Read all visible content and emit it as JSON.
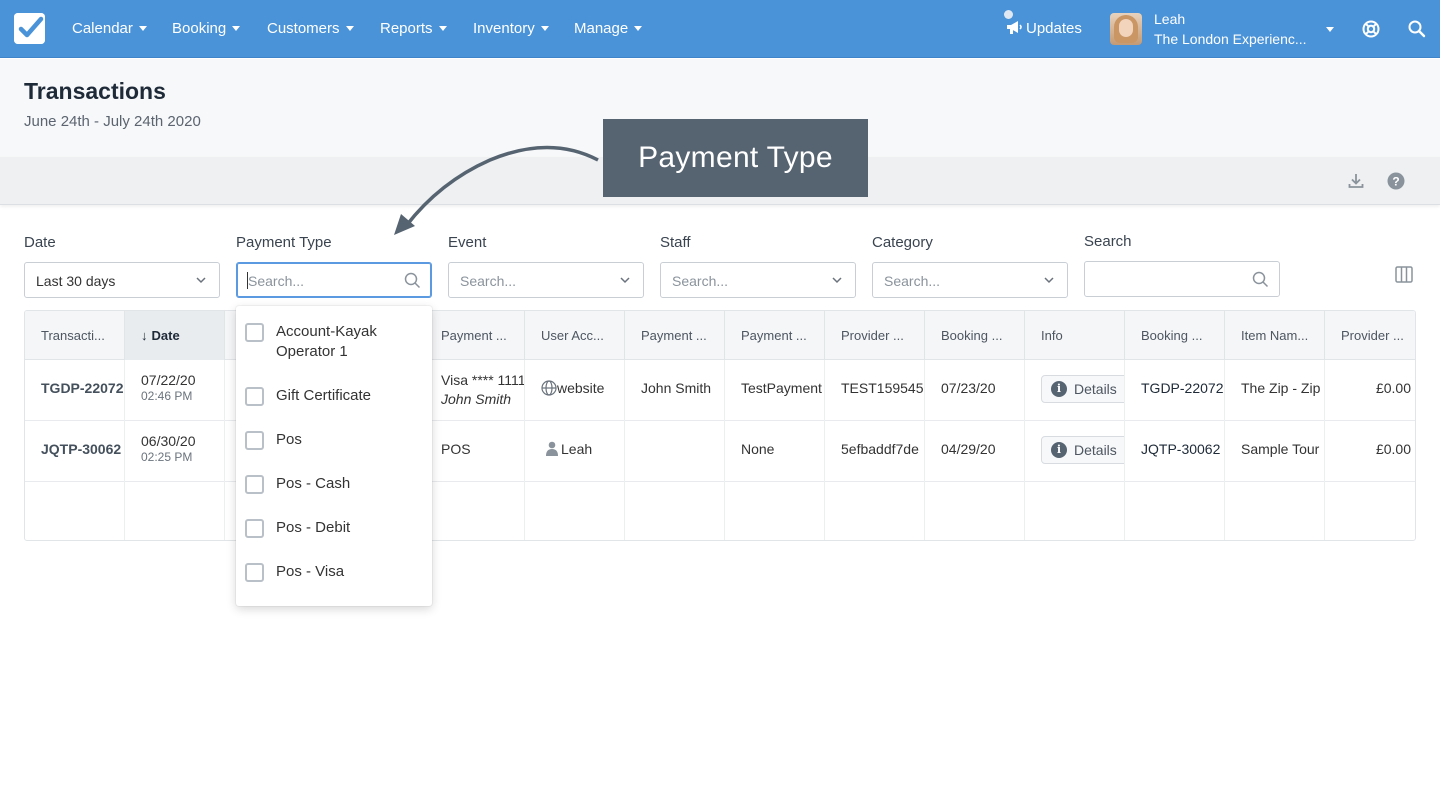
{
  "nav": {
    "items": [
      "Calendar",
      "Booking",
      "Customers",
      "Reports",
      "Inventory",
      "Manage"
    ],
    "updates_label": "Updates",
    "user_name": "Leah",
    "user_org": "The London Experienc..."
  },
  "page": {
    "title": "Transactions",
    "subtitle": "June 24th - July 24th 2020"
  },
  "callout": {
    "text": "Payment Type"
  },
  "filters": {
    "date": {
      "label": "Date",
      "value": "Last 30 days"
    },
    "payment_type": {
      "label": "Payment Type",
      "placeholder": "Search..."
    },
    "event": {
      "label": "Event",
      "placeholder": "Search..."
    },
    "staff": {
      "label": "Staff",
      "placeholder": "Search..."
    },
    "category": {
      "label": "Category",
      "placeholder": "Search..."
    },
    "search": {
      "label": "Search",
      "placeholder": ""
    }
  },
  "table": {
    "headers": [
      "Transacti...",
      "Date",
      "",
      "Payment ...",
      "User Acc...",
      "Payment ...",
      "Payment ...",
      "Provider ...",
      "Booking ...",
      "Info",
      "Booking ...",
      "Item Nam...",
      "Provider ..."
    ],
    "rows": [
      {
        "transaction": "TGDP-22072",
        "date": "07/22/20",
        "time": "02:46 PM",
        "payment_method": "Visa **** 1111",
        "payment_name": "John Smith",
        "user_account": "website",
        "payment_by": "John Smith",
        "payment_ref": "TestPayment",
        "provider_id": "TEST159545",
        "booking_date": "07/23/20",
        "info": "Details",
        "booking_code": "TGDP-22072",
        "item_name": "The Zip - Zip",
        "provider_amount": "£0.00"
      },
      {
        "transaction": "JQTP-30062",
        "date": "06/30/20",
        "time": "02:25 PM",
        "payment_method": "POS",
        "payment_name": "",
        "user_account": "Leah",
        "payment_by": "",
        "payment_ref": "None",
        "provider_id": "5efbaddf7de",
        "booking_date": "04/29/20",
        "info": "Details",
        "booking_code": "JQTP-30062",
        "item_name": "Sample Tour",
        "provider_amount": "£0.00"
      }
    ]
  },
  "dropdown": {
    "options": [
      "Account-Kayak Operator 1",
      "Gift Certificate",
      "Pos",
      "Pos - Cash",
      "Pos - Debit",
      "Pos - Visa"
    ]
  },
  "icons": {
    "logo": "checkbox-logo-icon",
    "updates": "megaphone-icon",
    "help": "lifebuoy-icon",
    "search": "search-icon",
    "download": "download-icon",
    "question": "question-icon",
    "columns": "columns-icon"
  },
  "colors": {
    "nav": "#4a93d8",
    "callout": "#566371",
    "focus": "#5b9ae0"
  }
}
